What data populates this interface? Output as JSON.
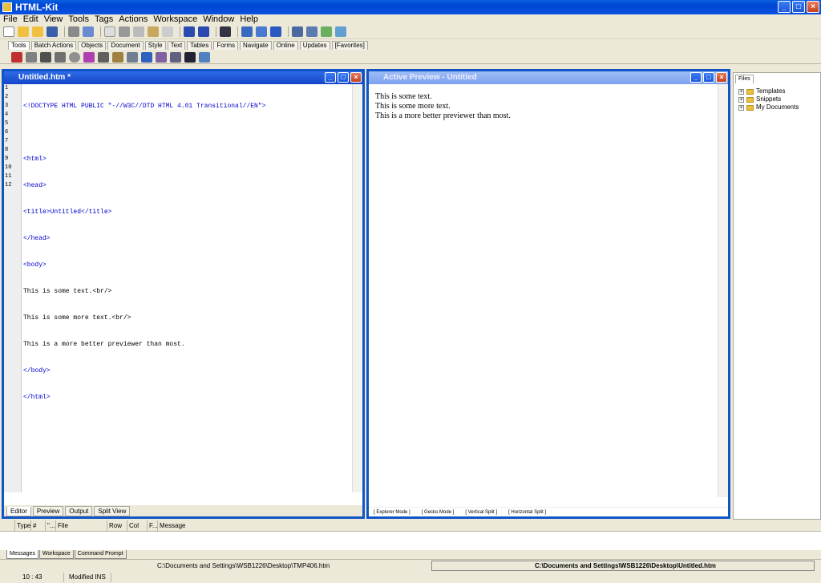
{
  "app": {
    "title": "HTML-Kit"
  },
  "window_buttons": {
    "minimize": "_",
    "maximize": "□",
    "close": "×"
  },
  "menu": [
    "File",
    "Edit",
    "View",
    "Tools",
    "Tags",
    "Actions",
    "Workspace",
    "Window",
    "Help"
  ],
  "command_tabs": [
    "Tools",
    "Batch Actions",
    "Objects",
    "Document",
    "Style",
    "Text",
    "Tables",
    "Forms",
    "Navigate",
    "Online",
    "Updates",
    "[Favorites]"
  ],
  "editor": {
    "title": "Untitled.htm *",
    "line_numbers": [
      "1",
      "2",
      "3",
      "4",
      "5",
      "6",
      "7",
      "8",
      "9",
      "10",
      "11",
      "12"
    ],
    "lines": [
      "<!DOCTYPE HTML PUBLIC \"-//W3C//DTD HTML 4.01 Transitional//EN\">",
      "",
      "<html>",
      "<head>",
      "<title>Untitled</title>",
      "</head>",
      "<body>",
      "This is some text.<br/>",
      "This is some more text.<br/>",
      "This is a more better previewer than most.",
      "</body>",
      "</html>"
    ],
    "tabs": [
      "Editor",
      "Preview",
      "Output",
      "Split View"
    ]
  },
  "preview": {
    "title": "Active Preview - Untitled",
    "lines": [
      "This is some text.",
      "This is some more text.",
      "This is a more better previewer than most."
    ],
    "modes": [
      "[ Explorer Mode ]",
      "[ Gecko Mode ]",
      "[ Vertical Split ]",
      "[ Horizontal Split ]"
    ]
  },
  "files": {
    "tab": "Files",
    "items": [
      "Templates",
      "Snippets",
      "My Documents"
    ]
  },
  "messages": {
    "columns": [
      "Type",
      "#",
      "\"...",
      "File",
      "Row",
      "Col",
      "F...",
      "Message"
    ],
    "tabs": [
      "Messages",
      "Workspace",
      "Command Prompt"
    ]
  },
  "status": {
    "path1": "C:\\Documents and Settings\\WSB1226\\Desktop\\TMP406.htm",
    "path2": "C:\\Documents and Settings\\WSB1226\\Desktop\\Untitled.htm",
    "position": "10 : 43",
    "mode": "Modified INS"
  },
  "colors": {
    "titlebar": "#0A52E0",
    "pane_border": "#0F55C8",
    "tag": "#0000cc"
  }
}
